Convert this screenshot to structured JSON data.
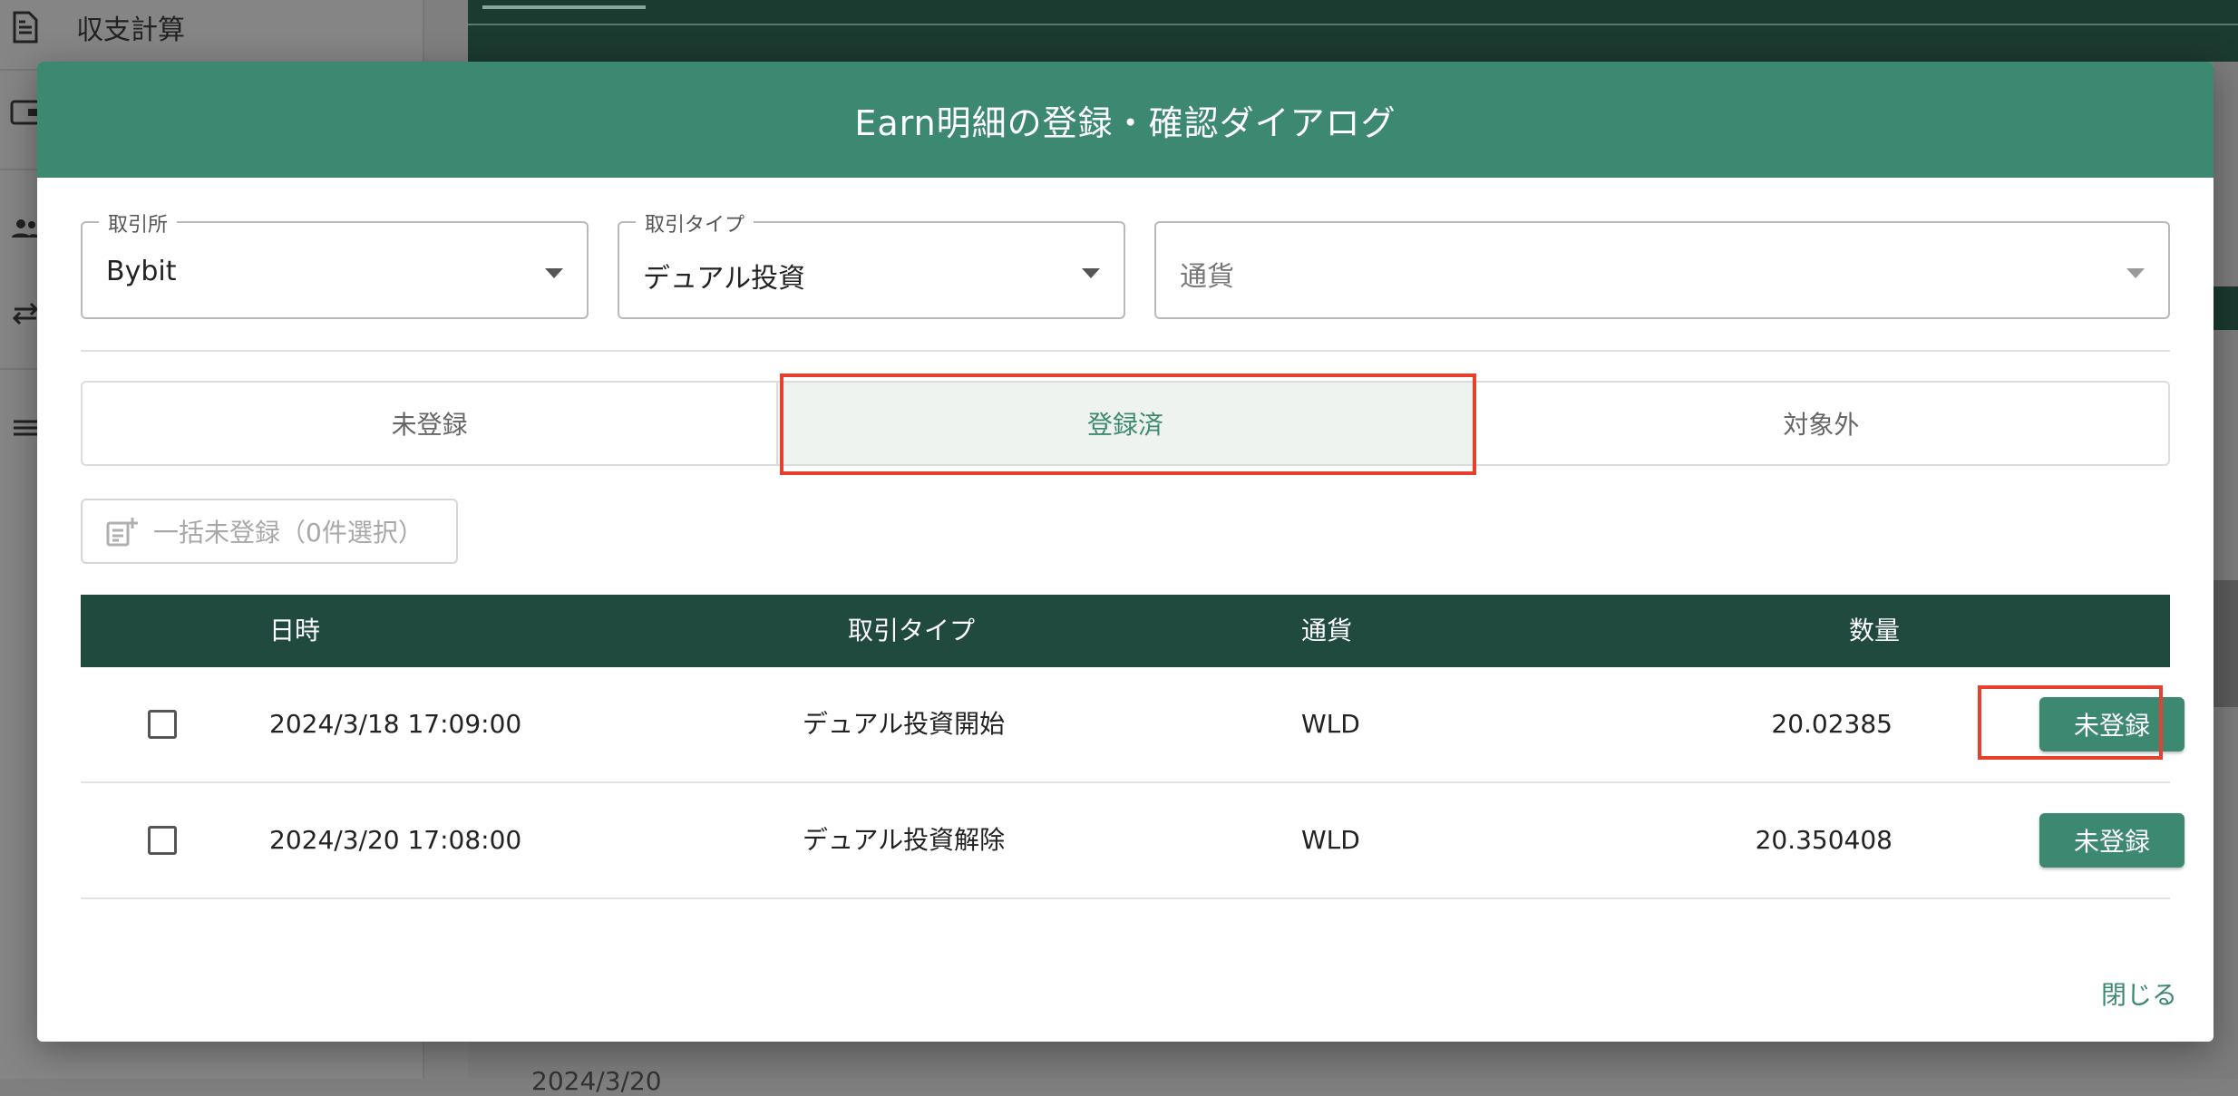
{
  "background": {
    "sidebar_item_label": "収支計算",
    "bottom_text": "2024/3/20"
  },
  "dialog": {
    "title": "Earn明細の登録・確認ダイアログ",
    "filters": {
      "exchange": {
        "label": "取引所",
        "value": "Bybit"
      },
      "type": {
        "label": "取引タイプ",
        "value": "デュアル投資"
      },
      "currency": {
        "placeholder": "通貨"
      }
    },
    "tabs": [
      {
        "label": "未登録",
        "active": false
      },
      {
        "label": "登録済",
        "active": true
      },
      {
        "label": "対象外",
        "active": false
      }
    ],
    "bulk_button": {
      "label": "一括未登録（0件選択）"
    },
    "table": {
      "headers": {
        "datetime": "日時",
        "type": "取引タイプ",
        "currency": "通貨",
        "amount": "数量"
      },
      "rows": [
        {
          "datetime": "2024/3/18 17:09:00",
          "type": "デュアル投資開始",
          "currency": "WLD",
          "amount": "20.02385",
          "action": "未登録"
        },
        {
          "datetime": "2024/3/20 17:08:00",
          "type": "デュアル投資解除",
          "currency": "WLD",
          "amount": "20.350408",
          "action": "未登録"
        }
      ]
    },
    "close_label": "閉じる"
  },
  "colors": {
    "header_green": "#3d8870",
    "table_header": "#1f4a3d",
    "highlight_red": "#e5412e"
  }
}
